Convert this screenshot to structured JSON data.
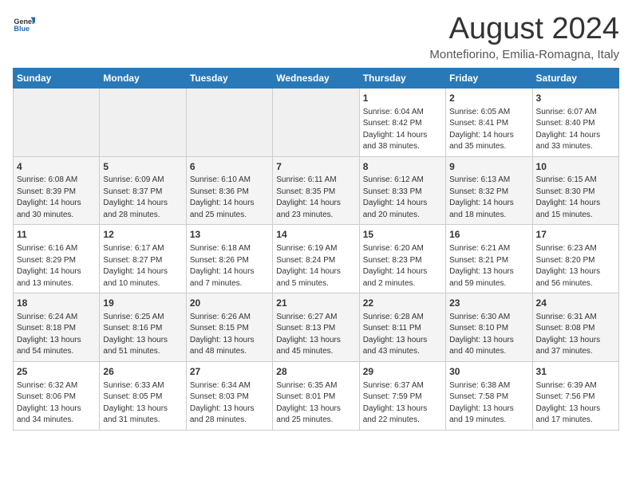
{
  "header": {
    "logo_general": "General",
    "logo_blue": "Blue",
    "month_title": "August 2024",
    "subtitle": "Montefiorino, Emilia-Romagna, Italy"
  },
  "days_of_week": [
    "Sunday",
    "Monday",
    "Tuesday",
    "Wednesday",
    "Thursday",
    "Friday",
    "Saturday"
  ],
  "weeks": [
    [
      {
        "day": "",
        "info": ""
      },
      {
        "day": "",
        "info": ""
      },
      {
        "day": "",
        "info": ""
      },
      {
        "day": "",
        "info": ""
      },
      {
        "day": "1",
        "info": "Sunrise: 6:04 AM\nSunset: 8:42 PM\nDaylight: 14 hours\nand 38 minutes."
      },
      {
        "day": "2",
        "info": "Sunrise: 6:05 AM\nSunset: 8:41 PM\nDaylight: 14 hours\nand 35 minutes."
      },
      {
        "day": "3",
        "info": "Sunrise: 6:07 AM\nSunset: 8:40 PM\nDaylight: 14 hours\nand 33 minutes."
      }
    ],
    [
      {
        "day": "4",
        "info": "Sunrise: 6:08 AM\nSunset: 8:39 PM\nDaylight: 14 hours\nand 30 minutes."
      },
      {
        "day": "5",
        "info": "Sunrise: 6:09 AM\nSunset: 8:37 PM\nDaylight: 14 hours\nand 28 minutes."
      },
      {
        "day": "6",
        "info": "Sunrise: 6:10 AM\nSunset: 8:36 PM\nDaylight: 14 hours\nand 25 minutes."
      },
      {
        "day": "7",
        "info": "Sunrise: 6:11 AM\nSunset: 8:35 PM\nDaylight: 14 hours\nand 23 minutes."
      },
      {
        "day": "8",
        "info": "Sunrise: 6:12 AM\nSunset: 8:33 PM\nDaylight: 14 hours\nand 20 minutes."
      },
      {
        "day": "9",
        "info": "Sunrise: 6:13 AM\nSunset: 8:32 PM\nDaylight: 14 hours\nand 18 minutes."
      },
      {
        "day": "10",
        "info": "Sunrise: 6:15 AM\nSunset: 8:30 PM\nDaylight: 14 hours\nand 15 minutes."
      }
    ],
    [
      {
        "day": "11",
        "info": "Sunrise: 6:16 AM\nSunset: 8:29 PM\nDaylight: 14 hours\nand 13 minutes."
      },
      {
        "day": "12",
        "info": "Sunrise: 6:17 AM\nSunset: 8:27 PM\nDaylight: 14 hours\nand 10 minutes."
      },
      {
        "day": "13",
        "info": "Sunrise: 6:18 AM\nSunset: 8:26 PM\nDaylight: 14 hours\nand 7 minutes."
      },
      {
        "day": "14",
        "info": "Sunrise: 6:19 AM\nSunset: 8:24 PM\nDaylight: 14 hours\nand 5 minutes."
      },
      {
        "day": "15",
        "info": "Sunrise: 6:20 AM\nSunset: 8:23 PM\nDaylight: 14 hours\nand 2 minutes."
      },
      {
        "day": "16",
        "info": "Sunrise: 6:21 AM\nSunset: 8:21 PM\nDaylight: 13 hours\nand 59 minutes."
      },
      {
        "day": "17",
        "info": "Sunrise: 6:23 AM\nSunset: 8:20 PM\nDaylight: 13 hours\nand 56 minutes."
      }
    ],
    [
      {
        "day": "18",
        "info": "Sunrise: 6:24 AM\nSunset: 8:18 PM\nDaylight: 13 hours\nand 54 minutes."
      },
      {
        "day": "19",
        "info": "Sunrise: 6:25 AM\nSunset: 8:16 PM\nDaylight: 13 hours\nand 51 minutes."
      },
      {
        "day": "20",
        "info": "Sunrise: 6:26 AM\nSunset: 8:15 PM\nDaylight: 13 hours\nand 48 minutes."
      },
      {
        "day": "21",
        "info": "Sunrise: 6:27 AM\nSunset: 8:13 PM\nDaylight: 13 hours\nand 45 minutes."
      },
      {
        "day": "22",
        "info": "Sunrise: 6:28 AM\nSunset: 8:11 PM\nDaylight: 13 hours\nand 43 minutes."
      },
      {
        "day": "23",
        "info": "Sunrise: 6:30 AM\nSunset: 8:10 PM\nDaylight: 13 hours\nand 40 minutes."
      },
      {
        "day": "24",
        "info": "Sunrise: 6:31 AM\nSunset: 8:08 PM\nDaylight: 13 hours\nand 37 minutes."
      }
    ],
    [
      {
        "day": "25",
        "info": "Sunrise: 6:32 AM\nSunset: 8:06 PM\nDaylight: 13 hours\nand 34 minutes."
      },
      {
        "day": "26",
        "info": "Sunrise: 6:33 AM\nSunset: 8:05 PM\nDaylight: 13 hours\nand 31 minutes."
      },
      {
        "day": "27",
        "info": "Sunrise: 6:34 AM\nSunset: 8:03 PM\nDaylight: 13 hours\nand 28 minutes."
      },
      {
        "day": "28",
        "info": "Sunrise: 6:35 AM\nSunset: 8:01 PM\nDaylight: 13 hours\nand 25 minutes."
      },
      {
        "day": "29",
        "info": "Sunrise: 6:37 AM\nSunset: 7:59 PM\nDaylight: 13 hours\nand 22 minutes."
      },
      {
        "day": "30",
        "info": "Sunrise: 6:38 AM\nSunset: 7:58 PM\nDaylight: 13 hours\nand 19 minutes."
      },
      {
        "day": "31",
        "info": "Sunrise: 6:39 AM\nSunset: 7:56 PM\nDaylight: 13 hours\nand 17 minutes."
      }
    ]
  ]
}
